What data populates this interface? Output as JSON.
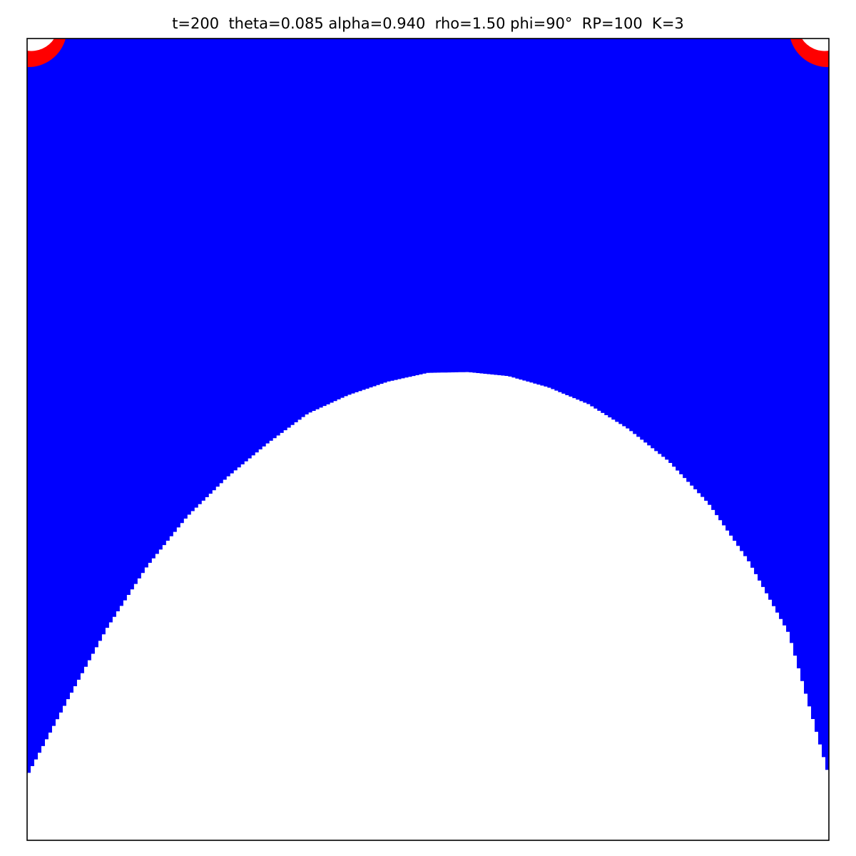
{
  "chart_data": {
    "type": "heatmap",
    "title": "t=200  theta=0.085 alpha=0.940  rho=1.50 phi=90°  RP=100  K=3",
    "xlabel": "",
    "ylabel": "",
    "axes_ticks": false,
    "grid": false,
    "legend": "none",
    "colors": {
      "background": "#ffffff",
      "fill": "#0000ff",
      "accent": "#ff0000",
      "frame": "#000000"
    },
    "regions": {
      "blue_region": "fills the domain above a dome-shaped white region whose apex is near the horizontal centre, about 42% down from the top; the white region spans the full width along the bottom (about the lowest 8%)",
      "white_dome_boundary_depth": [
        [
          0.0,
          0.92
        ],
        [
          0.05,
          0.826
        ],
        [
          0.1,
          0.735
        ],
        [
          0.15,
          0.658
        ],
        [
          0.2,
          0.596
        ],
        [
          0.25,
          0.547
        ],
        [
          0.3,
          0.505
        ],
        [
          0.35,
          0.468
        ],
        [
          0.4,
          0.445
        ],
        [
          0.45,
          0.428
        ],
        [
          0.5,
          0.417
        ],
        [
          0.55,
          0.416
        ],
        [
          0.6,
          0.421
        ],
        [
          0.65,
          0.435
        ],
        [
          0.7,
          0.456
        ],
        [
          0.75,
          0.487
        ],
        [
          0.8,
          0.527
        ],
        [
          0.85,
          0.58
        ],
        [
          0.9,
          0.652
        ],
        [
          0.95,
          0.742
        ],
        [
          1.0,
          0.92
        ]
      ],
      "red_corners": [
        "top-left",
        "top-right"
      ]
    }
  }
}
